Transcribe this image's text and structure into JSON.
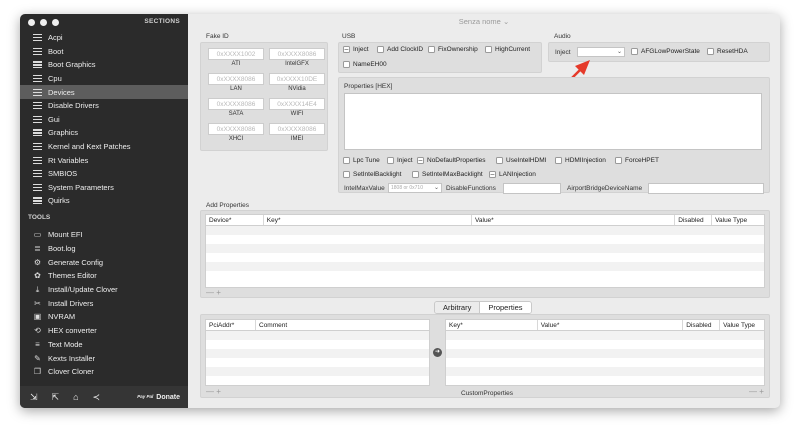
{
  "window_title": "Senza nome",
  "sidebar": {
    "header": "SECTIONS",
    "items": [
      {
        "label": "Acpi",
        "icon": "list-icon"
      },
      {
        "label": "Boot",
        "icon": "list-icon"
      },
      {
        "label": "Boot Graphics",
        "icon": "list-icon"
      },
      {
        "label": "Cpu",
        "icon": "list-icon"
      },
      {
        "label": "Devices",
        "icon": "list-icon",
        "selected": true
      },
      {
        "label": "Disable Drivers",
        "icon": "list-icon"
      },
      {
        "label": "Gui",
        "icon": "list-icon"
      },
      {
        "label": "Graphics",
        "icon": "list-icon"
      },
      {
        "label": "Kernel and Kext Patches",
        "icon": "list-icon"
      },
      {
        "label": "Rt Variables",
        "icon": "list-icon"
      },
      {
        "label": "SMBIOS",
        "icon": "list-icon"
      },
      {
        "label": "System Parameters",
        "icon": "list-icon"
      },
      {
        "label": "Quirks",
        "icon": "list-icon"
      }
    ],
    "tools_header": "TOOLS",
    "tools": [
      {
        "label": "Mount EFI",
        "icon": "disk-icon"
      },
      {
        "label": "Boot.log",
        "icon": "log-icon"
      },
      {
        "label": "Generate Config",
        "icon": "gears-icon"
      },
      {
        "label": "Themes Editor",
        "icon": "palette-icon"
      },
      {
        "label": "Install/Update Clover",
        "icon": "download-icon"
      },
      {
        "label": "Install Drivers",
        "icon": "wrench-icon"
      },
      {
        "label": "NVRAM",
        "icon": "chip-icon"
      },
      {
        "label": "HEX converter",
        "icon": "convert-icon"
      },
      {
        "label": "Text Mode",
        "icon": "text-icon"
      },
      {
        "label": "Kexts Installer",
        "icon": "kext-icon"
      },
      {
        "label": "Clover Cloner",
        "icon": "clone-icon"
      }
    ],
    "donate_small": "Pay Pal",
    "donate": "Donate"
  },
  "fake_id": {
    "title": "Fake ID",
    "fields": [
      {
        "placeholder": "0xXXXX1002",
        "label": "ATI"
      },
      {
        "placeholder": "0xXXXX8086",
        "label": "IntelGFX"
      },
      {
        "placeholder": "0xXXXX8086",
        "label": "LAN"
      },
      {
        "placeholder": "0xXXXX10DE",
        "label": "NVidia"
      },
      {
        "placeholder": "0xXXXX8086",
        "label": "SATA"
      },
      {
        "placeholder": "0xXXXX14E4",
        "label": "WIFI"
      },
      {
        "placeholder": "0xXXXX8086",
        "label": "XHCI"
      },
      {
        "placeholder": "0xXXXX8086",
        "label": "IMEI"
      }
    ]
  },
  "usb": {
    "title": "USB",
    "inject": "Inject",
    "add_clock_id": "Add ClockID",
    "fix_ownership": "FixOwnership",
    "high_current": "HighCurrent",
    "name_eh00": "NameEH00"
  },
  "audio": {
    "title": "Audio",
    "inject": "Inject",
    "afg": "AFGLowPowerState",
    "reset_hda": "ResetHDA"
  },
  "properties": {
    "title": "Properties [HEX]",
    "lpc_tune": "Lpc Tune",
    "inject": "Inject",
    "no_default_props": "NoDefaultProperties",
    "use_intel_hdmi": "UseIntelHDMI",
    "hdmi_injection": "HDMIInjection",
    "force_hpet": "ForceHPET",
    "set_intel_backlight": "SetIntelBacklight",
    "set_intel_max_backlight": "SetIntelMaxBacklight",
    "lan_injection": "LANInjection",
    "intel_max_value": "IntelMaxValue",
    "intel_max_placeholder": "1808 or 0x710",
    "disable_functions": "DisableFunctions",
    "airport_bridge": "AirportBridgeDeviceName"
  },
  "add_properties": {
    "title": "Add Properties",
    "columns": [
      "Device*",
      "Key*",
      "Value*",
      "Disabled",
      "Value Type"
    ]
  },
  "tabs": [
    "Arbitrary",
    "Properties"
  ],
  "pci_table": {
    "columns": [
      "PciAddr*",
      "Comment"
    ]
  },
  "custom_table": {
    "columns": [
      "Key*",
      "Value*",
      "Disabled",
      "Value Type"
    ],
    "footer": "CustomProperties"
  }
}
